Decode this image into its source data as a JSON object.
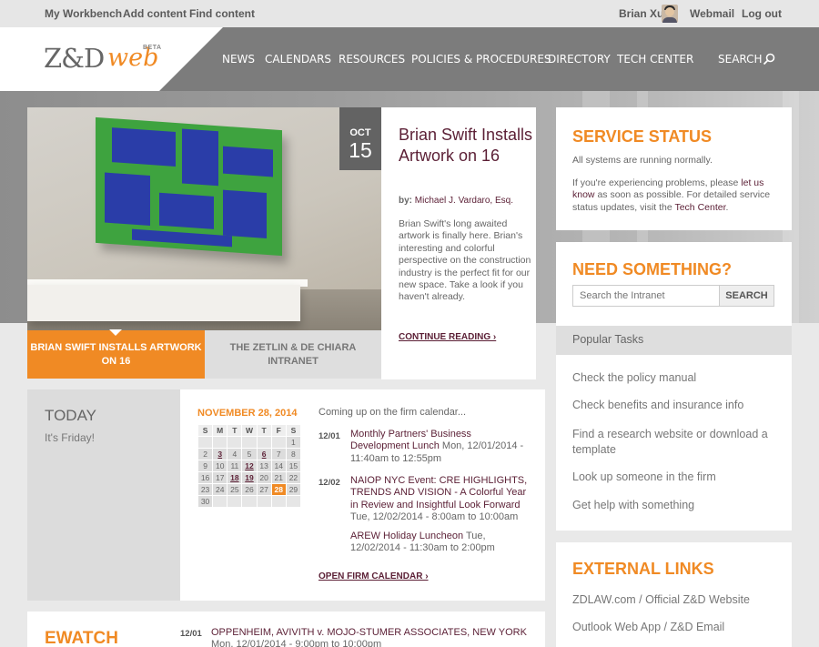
{
  "topbar": {
    "workbench": "My Workbench",
    "add_content": "Add content",
    "find_content": "Find content",
    "user_name": "Brian Xu",
    "webmail": "Webmail",
    "logout": "Log out"
  },
  "logo": {
    "zd": "Z&D",
    "web": "web",
    "beta": "BETA"
  },
  "nav": {
    "news": "NEWS",
    "calendars": "CALENDARS",
    "resources": "RESOURCES",
    "policies": "POLICIES & PROCEDURES",
    "directory": "DIRECTORY",
    "tech_center": "TECH CENTER",
    "search": "SEARCH"
  },
  "feature": {
    "month": "OCT",
    "day": "15",
    "title": "Brian Swift Installs Artwork on 16",
    "by_label": "by:",
    "author": "Michael J. Vardaro, Esq.",
    "body": "Brian Swift's long awaited artwork is finally here. Brian's interesting and colorful perspective on the construction industry is the perfect fit for our new space. Take a look if you haven't already.",
    "continue": "CONTINUE READING ›",
    "tab_active": "BRIAN SWIFT INSTALLS ARTWORK ON 16",
    "tab_inactive": "THE ZETLIN & DE CHIARA INTRANET"
  },
  "today": {
    "title": "TODAY",
    "subtitle": "It's Friday!"
  },
  "calendar": {
    "date_heading": "NOVEMBER 28, 2014",
    "weekdays": [
      "S",
      "M",
      "T",
      "W",
      "T",
      "F",
      "S"
    ],
    "weeks": [
      [
        "",
        "",
        "",
        "",
        "",
        "",
        "1"
      ],
      [
        "2",
        "3",
        "4",
        "5",
        "6",
        "7",
        "8"
      ],
      [
        "9",
        "10",
        "11",
        "12",
        "13",
        "14",
        "15"
      ],
      [
        "16",
        "17",
        "18",
        "19",
        "20",
        "21",
        "22"
      ],
      [
        "23",
        "24",
        "25",
        "26",
        "27",
        "28",
        "29"
      ],
      [
        "30",
        "",
        "",
        "",
        "",
        "",
        ""
      ]
    ],
    "event_days": [
      "3",
      "6",
      "12",
      "18",
      "19"
    ],
    "current_day": "28",
    "upcoming_heading": "Coming up on the firm calendar...",
    "events": [
      {
        "date": "12/01",
        "title": "Monthly Partners' Business Development Lunch",
        "details": "Mon, 12/01/2014 - 11:40am to 12:55pm"
      },
      {
        "date": "12/02",
        "title": "NAIOP NYC Event: CRE HIGHLIGHTS, TRENDS AND VISION - A Colorful Year in Review and Insightful Look Forward",
        "details": "Tue, 12/02/2014 - 8:00am to 10:00am"
      },
      {
        "date": "",
        "title": "AREW Holiday Luncheon",
        "details": "Tue, 12/02/2014 - 11:30am to 2:00pm"
      }
    ],
    "open_link": "OPEN FIRM CALENDAR ›"
  },
  "ewatch": {
    "title": "EWATCH",
    "date": "12/01",
    "item_title": "OPPENHEIM, AVIVITH v. MOJO-STUMER ASSOCIATES, NEW YORK",
    "item_details": "Mon, 12/01/2014 - 9:00pm to 10:00pm"
  },
  "service_status": {
    "title": "SERVICE STATUS",
    "normal": "All systems are running normally.",
    "p1": "If you're experiencing problems, please",
    "link1": "let us know",
    "p2": "as soon as possible. For detailed service status updates, visit the",
    "link2": "Tech Center",
    "p3": "."
  },
  "need_something": {
    "title": "NEED SOMETHING?",
    "placeholder": "Search the Intranet",
    "button": "SEARCH",
    "popular_heading": "Popular Tasks",
    "tasks": [
      "Check the policy manual",
      "Check benefits and insurance info",
      "Find a research website or download a template",
      "Look up someone in the firm",
      "Get help with something"
    ]
  },
  "external_links": {
    "title": "EXTERNAL LINKS",
    "links": [
      "ZDLAW.com / Official Z&D Website",
      "Outlook Web App / Z&D Email"
    ]
  },
  "colors": {
    "accent": "#f08a24",
    "link": "#5b1f35",
    "header": "#7c7c7c"
  }
}
